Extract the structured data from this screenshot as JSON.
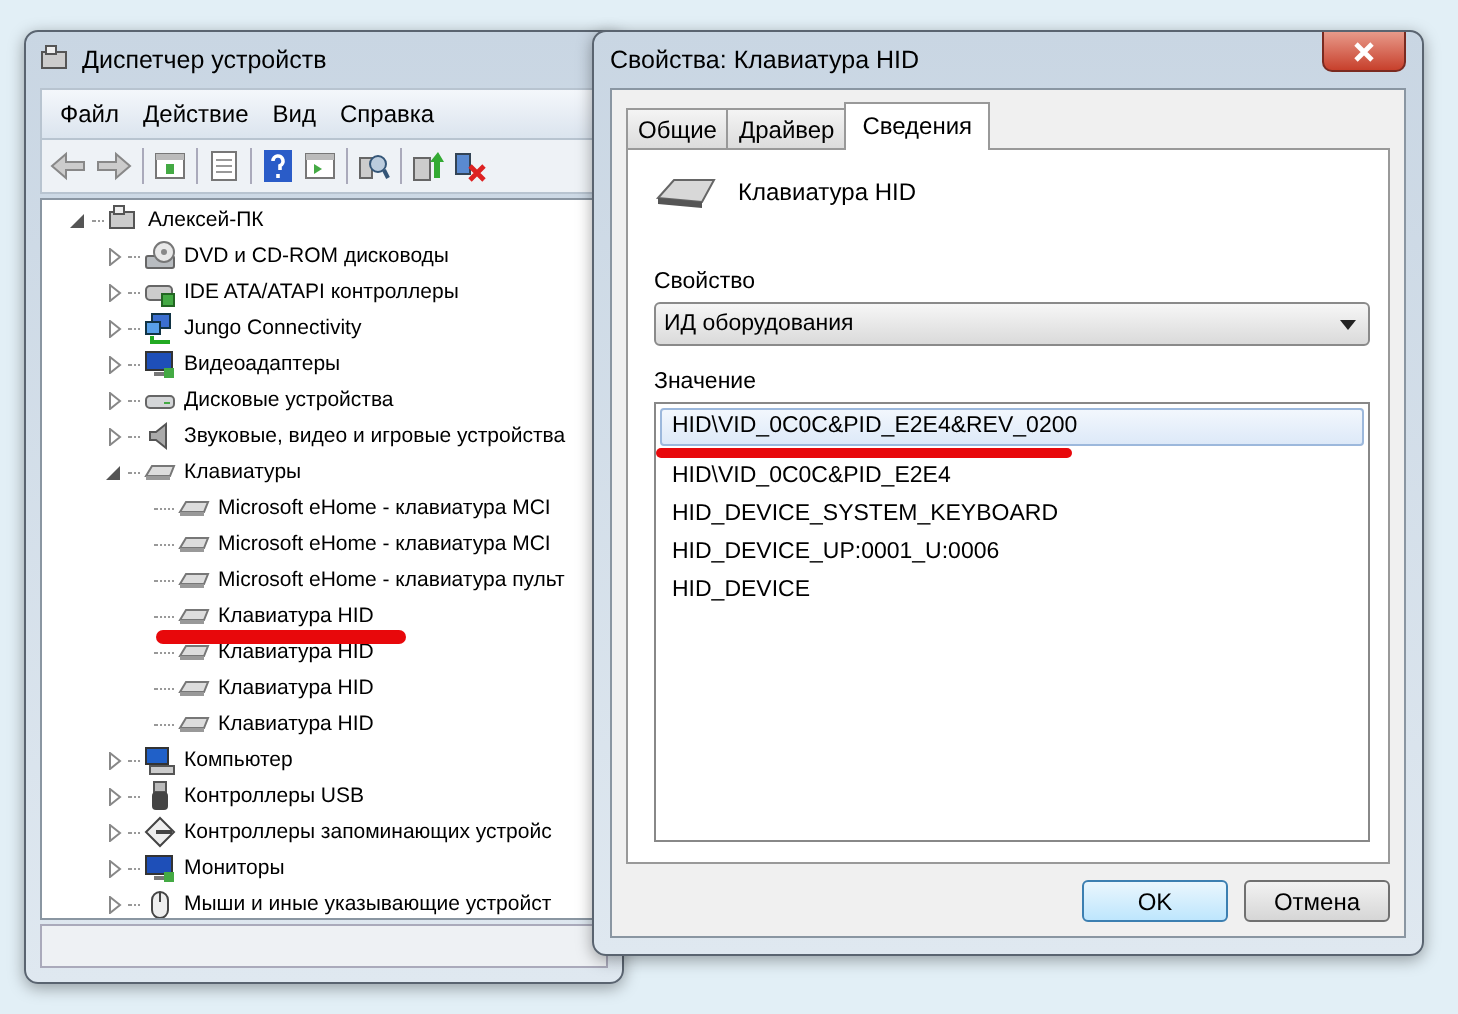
{
  "device_manager": {
    "title": "Диспетчер устройств",
    "menu": [
      {
        "label": "Файл"
      },
      {
        "label": "Действие"
      },
      {
        "label": "Вид"
      },
      {
        "label": "Справка"
      }
    ],
    "tree": {
      "label": "Алексей-ПК",
      "expanded": true,
      "children": [
        {
          "label": "DVD и CD-ROM дисководы",
          "expanded": false
        },
        {
          "label": "IDE ATA/ATAPI контроллеры",
          "expanded": false
        },
        {
          "label": "Jungo Connectivity",
          "expanded": false
        },
        {
          "label": "Видеоадаптеры",
          "expanded": false
        },
        {
          "label": "Дисковые устройства",
          "expanded": false
        },
        {
          "label": "Звуковые, видео и игровые устройства",
          "expanded": false
        },
        {
          "label": "Клавиатуры",
          "expanded": true,
          "children": [
            {
              "label": "Microsoft eHome - клавиатура MCI"
            },
            {
              "label": "Microsoft eHome - клавиатура MCI"
            },
            {
              "label": "Microsoft eHome - клавиатура пульт"
            },
            {
              "label": "Клавиатура HID"
            },
            {
              "label": "Клавиатура HID"
            },
            {
              "label": "Клавиатура HID"
            },
            {
              "label": "Клавиатура HID"
            }
          ]
        },
        {
          "label": "Компьютер",
          "expanded": false
        },
        {
          "label": "Контроллеры USB",
          "expanded": false
        },
        {
          "label": "Контроллеры запоминающих устройс",
          "expanded": false
        },
        {
          "label": "Мониторы",
          "expanded": false
        },
        {
          "label": "Мыши и иные указывающие устройст",
          "expanded": false
        }
      ]
    }
  },
  "dialog": {
    "title": "Свойства: Клавиатура HID",
    "tabs": [
      {
        "label": "Общие",
        "selected": false
      },
      {
        "label": "Драйвер",
        "selected": false
      },
      {
        "label": "Сведения",
        "selected": true
      }
    ],
    "device_name": "Клавиатура HID",
    "property_label": "Свойство",
    "property": {
      "value": "ИД оборудования"
    },
    "value_label": "Значение",
    "values": [
      {
        "text": "HID\\VID_0C0C&PID_E2E4&REV_0200",
        "selected": true
      },
      {
        "text": "HID\\VID_0C0C&PID_E2E4",
        "selected": false
      },
      {
        "text": "HID_DEVICE_SYSTEM_KEYBOARD",
        "selected": false
      },
      {
        "text": "HID_DEVICE_UP:0001_U:0006",
        "selected": false
      },
      {
        "text": "HID_DEVICE",
        "selected": false
      }
    ],
    "buttons": [
      "OK",
      "Отмена"
    ]
  }
}
